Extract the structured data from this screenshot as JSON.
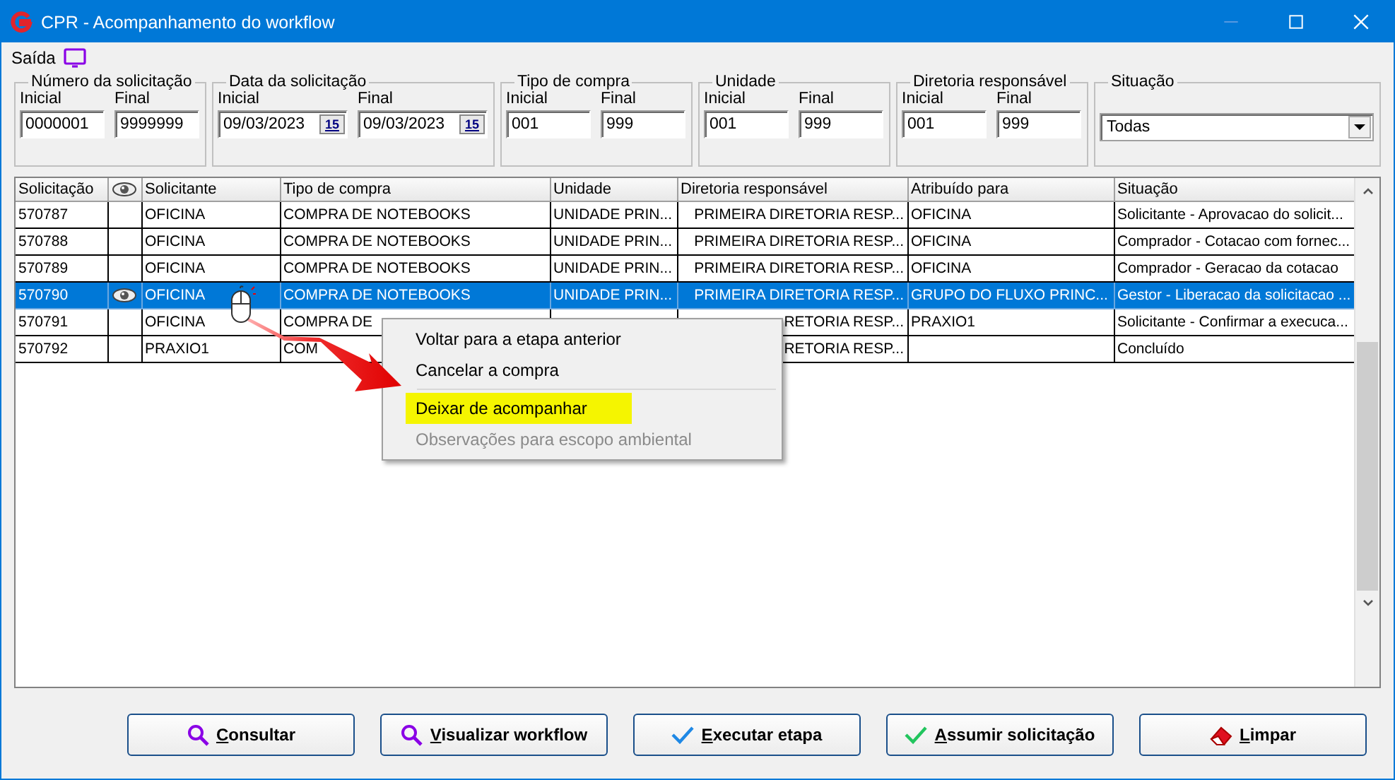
{
  "window": {
    "title": "CPR - Acompanhamento do workflow"
  },
  "menu_bar": {
    "label": "Saída"
  },
  "filters": [
    {
      "title": "Número da solicitação",
      "kind": "text",
      "fields": [
        {
          "label": "Inicial",
          "value": "0000001"
        },
        {
          "label": "Final",
          "value": "9999999"
        }
      ]
    },
    {
      "title": "Data da solicitação",
      "kind": "date",
      "fields": [
        {
          "label": "Inicial",
          "value": "09/03/2023",
          "button_text": "15"
        },
        {
          "label": "Final",
          "value": "09/03/2023",
          "button_text": "15"
        }
      ]
    },
    {
      "title": "Tipo de compra",
      "kind": "text",
      "fields": [
        {
          "label": "Inicial",
          "value": "001"
        },
        {
          "label": "Final",
          "value": "999"
        }
      ]
    },
    {
      "title": "Unidade",
      "kind": "text",
      "fields": [
        {
          "label": "Inicial",
          "value": "001"
        },
        {
          "label": "Final",
          "value": "999"
        }
      ]
    },
    {
      "title": "Diretoria responsável",
      "kind": "text",
      "fields": [
        {
          "label": "Inicial",
          "value": "001"
        },
        {
          "label": "Final",
          "value": "999"
        }
      ]
    },
    {
      "title": "Situação",
      "kind": "dropdown",
      "value": "Todas"
    }
  ],
  "table": {
    "columns": [
      "Solicitação",
      "",
      "Solicitante",
      "Tipo de compra",
      "Unidade",
      "Diretoria responsável",
      "Atribuído para",
      "Situação"
    ],
    "rows": [
      {
        "selected": false,
        "watched": false,
        "cells": [
          "570787",
          "",
          "OFICINA",
          "COMPRA DE NOTEBOOKS",
          "UNIDADE PRIN...",
          "PRIMEIRA DIRETORIA RESP...",
          "OFICINA",
          "Solicitante - Aprovacao do solicit..."
        ]
      },
      {
        "selected": false,
        "watched": false,
        "cells": [
          "570788",
          "",
          "OFICINA",
          "COMPRA DE NOTEBOOKS",
          "UNIDADE PRIN...",
          "PRIMEIRA DIRETORIA RESP...",
          "OFICINA",
          "Comprador - Cotacao com fornec..."
        ]
      },
      {
        "selected": false,
        "watched": false,
        "cells": [
          "570789",
          "",
          "OFICINA",
          "COMPRA DE NOTEBOOKS",
          "UNIDADE PRIN...",
          "PRIMEIRA DIRETORIA RESP...",
          "OFICINA",
          "Comprador - Geracao da cotacao"
        ]
      },
      {
        "selected": true,
        "watched": true,
        "cells": [
          "570790",
          "",
          "OFICINA",
          "COMPRA DE NOTEBOOKS",
          "UNIDADE PRIN...",
          "PRIMEIRA DIRETORIA RESP...",
          "GRUPO DO FLUXO PRINC...",
          "Gestor - Liberacao da solicitacao ..."
        ]
      },
      {
        "selected": false,
        "watched": false,
        "cells": [
          "570791",
          "",
          "OFICINA",
          "COMPRA DE",
          "",
          "RETORIA RESP...",
          "PRAXIO1",
          "Solicitante - Confirmar a execuca..."
        ]
      },
      {
        "selected": false,
        "watched": false,
        "cells": [
          "570792",
          "",
          "PRAXIO1",
          "COM",
          "",
          "RETORIA RESP...",
          "",
          "Concluído"
        ]
      }
    ]
  },
  "context_menu": [
    {
      "kind": "item",
      "label": "Voltar para a etapa anterior",
      "highlighted": false,
      "disabled": false
    },
    {
      "kind": "item",
      "label": "Cancelar a compra",
      "highlighted": false,
      "disabled": false
    },
    {
      "kind": "separator"
    },
    {
      "kind": "item",
      "label": "Deixar de acompanhar",
      "highlighted": true,
      "disabled": false
    },
    {
      "kind": "item",
      "label": "Observações para escopo ambiental",
      "highlighted": false,
      "disabled": true
    }
  ],
  "buttons": [
    {
      "label": "Consultar"
    },
    {
      "label": "Visualizar workflow"
    },
    {
      "label": "Executar etapa"
    },
    {
      "label": "Assumir solicitação"
    },
    {
      "label": "Limpar"
    }
  ]
}
